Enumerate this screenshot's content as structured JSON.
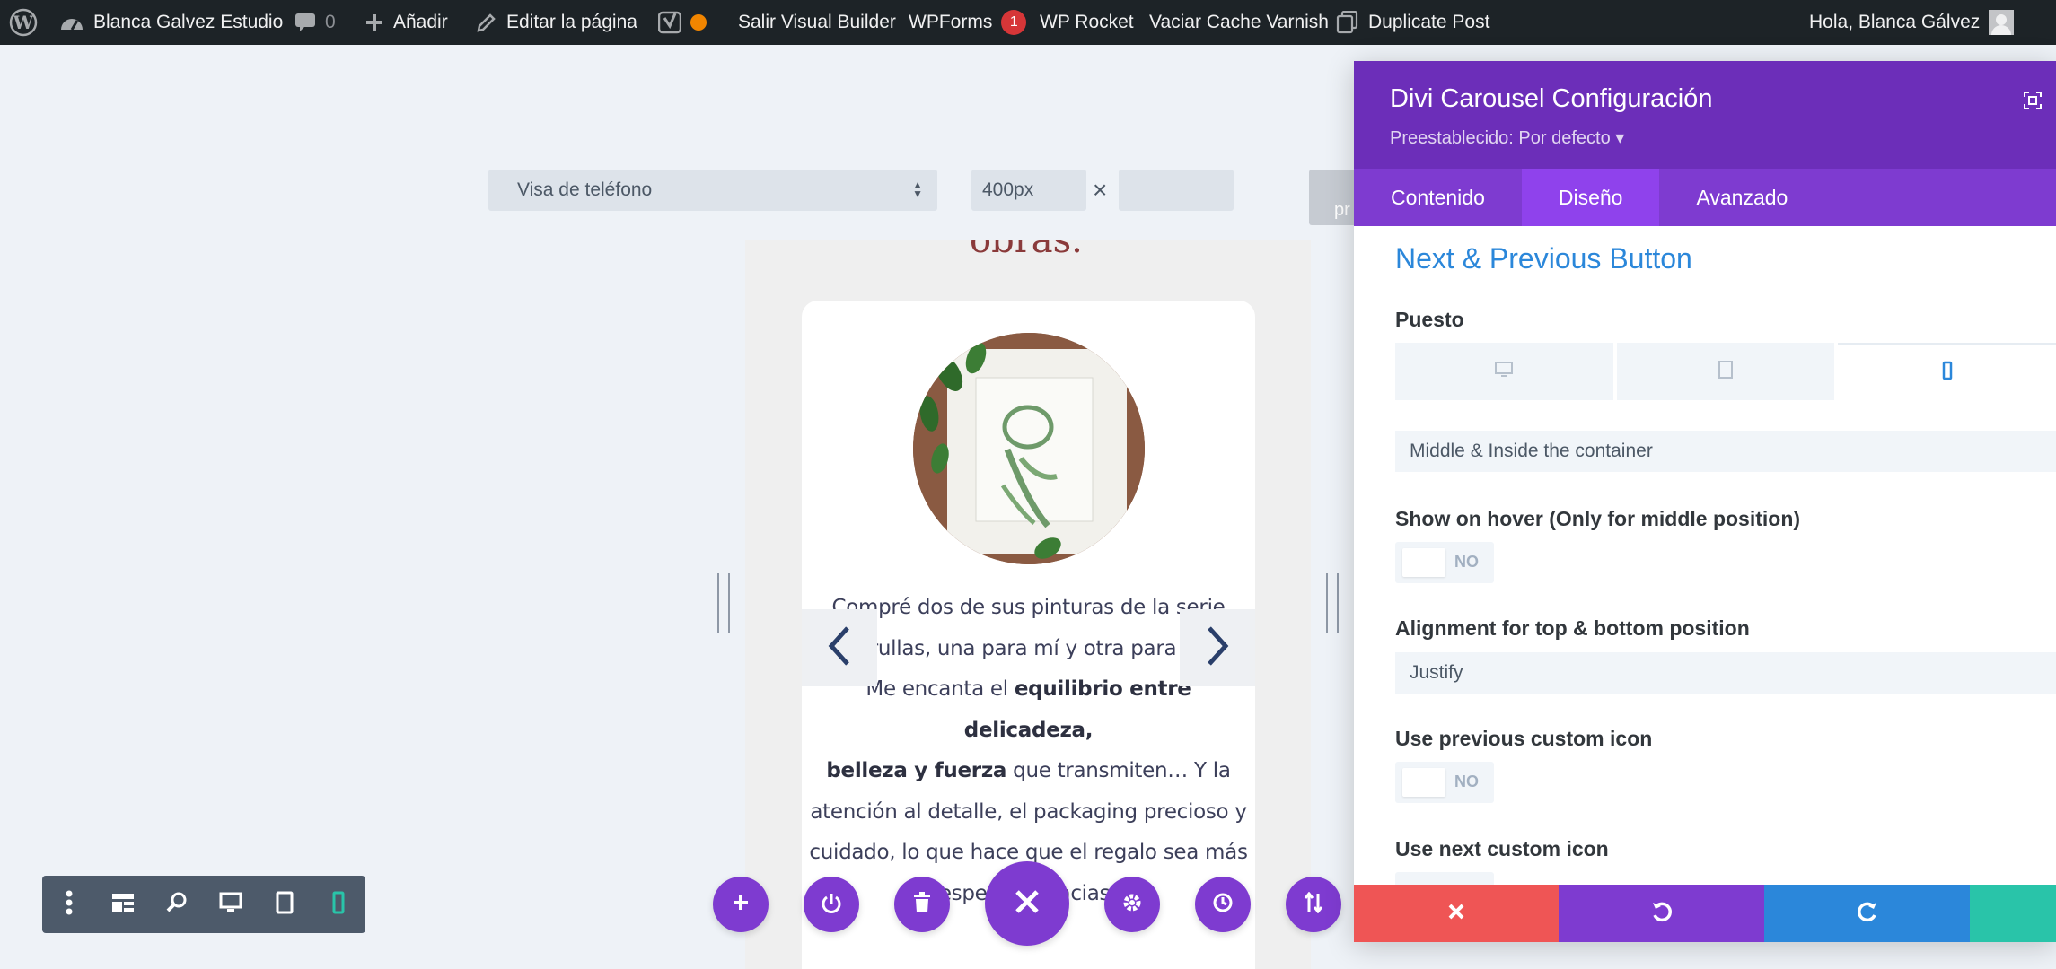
{
  "adminbar": {
    "site_name": "Blanca Galvez Estudio",
    "comments_count": "0",
    "add_new": "Añadir",
    "edit_page": "Editar la página",
    "exit_vb": "Salir Visual Builder",
    "wpforms": "WPForms",
    "wpforms_badge": "1",
    "wp_rocket": "WP Rocket",
    "varnish": "Vaciar Cache Varnish",
    "duplicate": "Duplicate Post",
    "greeting": "Hola, Blanca Gálvez"
  },
  "preview": {
    "device_select": "Visa de teléfono",
    "width_value": "400px",
    "times": "×",
    "ghost_button": "pr"
  },
  "content": {
    "heading_fragment": "obras.",
    "testimonial_parts": {
      "l1": "Compré dos de sus pinturas de la serie",
      "l2": "Grullas, una para mí y otra para re",
      "l3a": "Me encanta el ",
      "l3b": "equilibrio entre delicadeza,",
      "l4a": "belleza y fuerza",
      "l4b": " que transmiten… Y la",
      "l5": "atención al detalle, el packaging precioso y",
      "l6": "cuidado, lo que hace que el regalo sea más",
      "l7": "especial. Gracias!"
    }
  },
  "panel": {
    "title": "Divi Carousel Configuración",
    "preset": "Preestablecido: Por defecto ▾",
    "tabs": [
      "Contenido",
      "Diseño",
      "Avanzado"
    ],
    "active_tab": "Diseño",
    "section_title": "Next & Previous Button",
    "position_label": "Puesto",
    "position_value": "Middle & Inside the container",
    "hover_label": "Show on hover (Only for middle position)",
    "hover_value": "NO",
    "alignment_label": "Alignment for top & bottom position",
    "alignment_value": "Justify",
    "prev_icon_label": "Use previous custom icon",
    "prev_icon_value": "NO",
    "next_icon_label": "Use next custom icon"
  },
  "colors": {
    "adminbar": "#1d2327",
    "divi_purple": "#7e3bd0",
    "panel_header": "#6c2eb9",
    "section_blue": "#2b87da",
    "footer_red": "#ef5555",
    "footer_purple": "#7e3bd0",
    "footer_blue": "#2b87da",
    "footer_green": "#29c4a9"
  }
}
